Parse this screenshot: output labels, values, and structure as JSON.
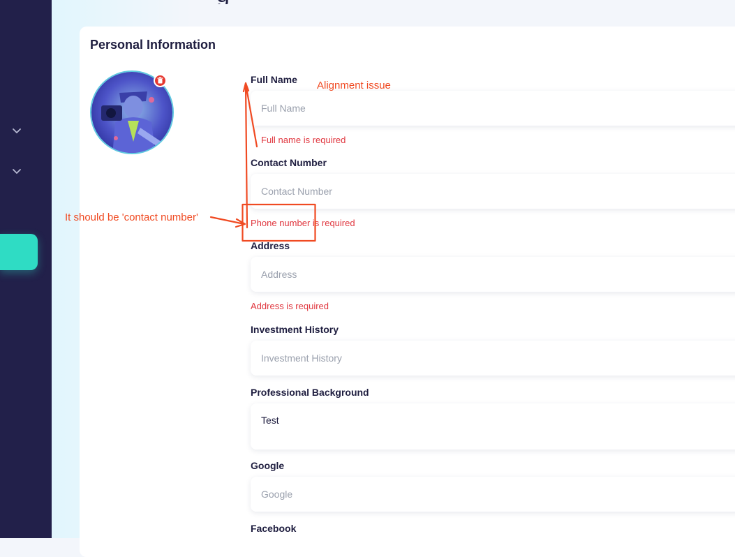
{
  "sidebar": {
    "chevrons": [
      "chevron-down-icon",
      "chevron-down-icon"
    ],
    "active_color": "#2fdcc4",
    "background": "#22204a"
  },
  "page": {
    "heading_fragment": "g"
  },
  "card": {
    "title": "Personal Information",
    "avatar": {
      "icon": "avatar-image",
      "delete_icon": "trash-icon"
    },
    "fields": {
      "full_name": {
        "label": "Full Name",
        "placeholder": "Full Name",
        "value": "",
        "error": "Full name is required"
      },
      "contact_number": {
        "label": "Contact Number",
        "placeholder": "Contact Number",
        "value": "",
        "error": "Phone number is required"
      },
      "address": {
        "label": "Address",
        "placeholder": "Address",
        "value": "",
        "error": "Address is required"
      },
      "investment_history": {
        "label": "Investment History",
        "placeholder": "Investment History",
        "value": ""
      },
      "professional_background": {
        "label": "Professional Background",
        "value": "Test"
      },
      "google": {
        "label": "Google",
        "placeholder": "Google",
        "value": ""
      },
      "facebook": {
        "label": "Facebook"
      }
    }
  },
  "annotations": {
    "alignment": "Alignment issue",
    "contact": "It should be 'contact number'",
    "color": "#f04a22"
  }
}
